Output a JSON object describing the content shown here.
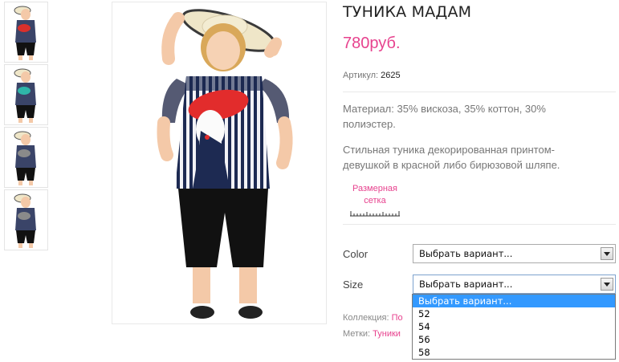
{
  "product": {
    "title": "ТУНИКА МАДАМ",
    "price": "780руб.",
    "sku_label": "Артикул:",
    "sku_value": "2625",
    "material": "Материал: 35% вискоза, 35% коттон, 30% полиэстер.",
    "description": "Стильная туника декорированная принтом-девушкой в красной либо бирюзовой шляпе.",
    "size_chart_label": "Размерная сетка"
  },
  "thumbnails": [
    {
      "alt": "thumbnail-1",
      "print_color": "#d9302c"
    },
    {
      "alt": "thumbnail-2",
      "print_color": "#2fb5a8"
    },
    {
      "alt": "thumbnail-3",
      "print_color": "#8a8a8a"
    },
    {
      "alt": "thumbnail-4",
      "print_color": "#8a8a8a"
    }
  ],
  "options": {
    "color": {
      "label": "Color",
      "selected": "Выбрать вариант..."
    },
    "size": {
      "label": "Size",
      "selected": "Выбрать вариант...",
      "items": [
        "Выбрать вариант...",
        "52",
        "54",
        "56",
        "58"
      ],
      "highlighted_index": 0
    }
  },
  "meta": {
    "collection_label": "Коллекция:",
    "collection_value": "По",
    "tags_label": "Метки:",
    "tags_value": "Туники"
  },
  "colors": {
    "accent": "#e7428e",
    "highlight": "#3399ff"
  }
}
